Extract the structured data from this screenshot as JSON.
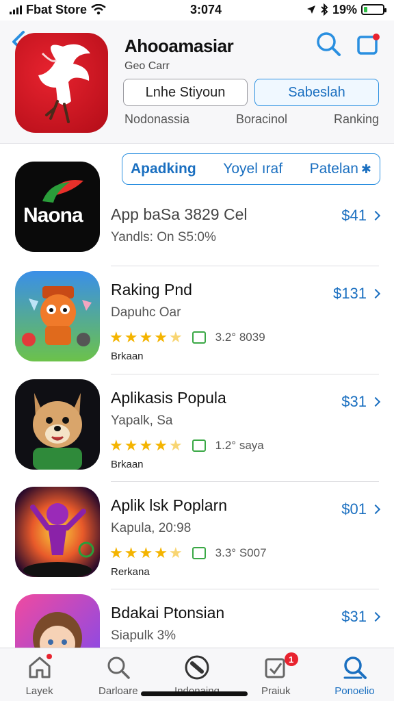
{
  "status_bar": {
    "carrier": "Fbat Store",
    "time": "3:074",
    "battery_percent": "19%"
  },
  "header": {
    "app_title": "Ahooamasiar",
    "app_subtitle": "Geo Carr",
    "button_outline": "Lnhe Stiyoun",
    "button_primary": "Sabeslah",
    "meta": [
      "Nodonassia",
      "Boracinol",
      "Ranking"
    ]
  },
  "segments": {
    "items": [
      "Apadking",
      "Yoyel ıraf",
      "Patelan"
    ],
    "active_index": 0
  },
  "featured": {
    "logo_text": "Naona"
  },
  "apps": [
    {
      "name": "App baSa 3829 Cel",
      "sub": "Yandls: On S5:0%",
      "price": "$41",
      "rating": null,
      "rating_count": "",
      "category": "",
      "icon": "naona-logo-icon"
    },
    {
      "name": "Raking Pnd",
      "sub": "Dapuhc Oar",
      "price": "$131",
      "rating": 4.5,
      "rating_count": "3.2° 8039",
      "category": "Brkaan",
      "icon": "orange-monster-icon"
    },
    {
      "name": "Aplikasis Popula",
      "sub": "Yapalk, Sa",
      "price": "$31",
      "rating": 4.5,
      "rating_count": "1.2° saya",
      "category": "Brkaan",
      "icon": "fox-character-icon"
    },
    {
      "name": "Aplik lsk Poplarn",
      "sub": "Kapula, 20:98",
      "price": "$01",
      "rating": 4.5,
      "rating_count": "3.3° S007",
      "category": "Rerkana",
      "icon": "dancer-character-icon"
    },
    {
      "name": "Bdakai Ptonsian",
      "sub": "Siapulk 3%",
      "price": "$31",
      "rating": null,
      "rating_count": "",
      "category": "",
      "icon": "girl-character-icon"
    }
  ],
  "tabs": [
    {
      "label": "Layek",
      "icon": "home-icon",
      "badge": "",
      "dot": true
    },
    {
      "label": "Darloare",
      "icon": "search-icon",
      "badge": "",
      "dot": false
    },
    {
      "label": "Indonaing",
      "icon": "compass-icon",
      "badge": "",
      "dot": false
    },
    {
      "label": "Praiuk",
      "icon": "updates-icon",
      "badge": "1",
      "dot": false
    },
    {
      "label": "Ponoelio",
      "icon": "search-tab-icon",
      "badge": "",
      "dot": false
    }
  ],
  "active_tab": 4,
  "colors": {
    "accent": "#1a6fc0",
    "star": "#f4b400",
    "badge": "#e8232f"
  }
}
